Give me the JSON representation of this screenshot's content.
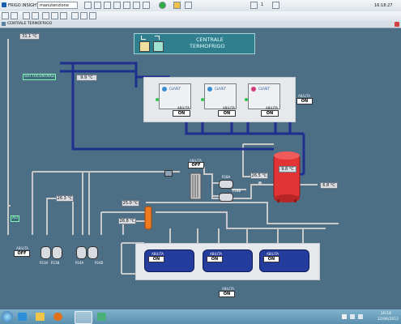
{
  "titlebar": {
    "app_name": "FRIGO INSIGHT",
    "mode": "manutenzione",
    "page_num": "1",
    "time": "16:18:27"
  },
  "window": {
    "tab_title": "CENTRALE TERMOFRIGO",
    "outside_temp": "31.1 °C"
  },
  "header": {
    "title_line1": "CENTRALE",
    "title_line2": "TERMOFRIGO"
  },
  "labels": {
    "sottocentrali": "SOTTOCENTRALI",
    "aci": "ACI"
  },
  "temps": {
    "t_sottocentrali": "9.9 °C",
    "t_tank": "9.8 °C",
    "t_tank_out": "6.8 °C",
    "t_left_line": "26.3 °C",
    "t_pumps": "26.5 °C",
    "t_mid1": "25.0 °C",
    "t_mid2": "26.8 °C"
  },
  "chillers": {
    "abilita": "ABILITA",
    "states": [
      "ON",
      "ON",
      "ON"
    ],
    "group_abilita": "ABILITA",
    "group_state": "ON",
    "brand": "CLIVET"
  },
  "exchanger": {
    "abilita": "ABILITA",
    "state": "OFF"
  },
  "pumps_hx": {
    "p1": "P28A",
    "p2": "P28B"
  },
  "pumps_left": {
    "abilita": "ABILITA",
    "state": "OFF",
    "p1": "P23A",
    "p2": "P23B",
    "p3": "P24A",
    "p4": "P24B"
  },
  "coolers": {
    "abilita": "ABILITA",
    "states": [
      "ON",
      "ON",
      "ON"
    ],
    "group_abilita": "ABILITA",
    "group_state": "ON"
  },
  "taskbar": {
    "time": "16:18",
    "date": "22/06/2012"
  },
  "colors": {
    "pipe_blue": "#1f2f8f",
    "pipe_grey": "#c9c9c9",
    "background": "#4d6f86",
    "tank": "#e23434",
    "cooler": "#243c9c"
  }
}
